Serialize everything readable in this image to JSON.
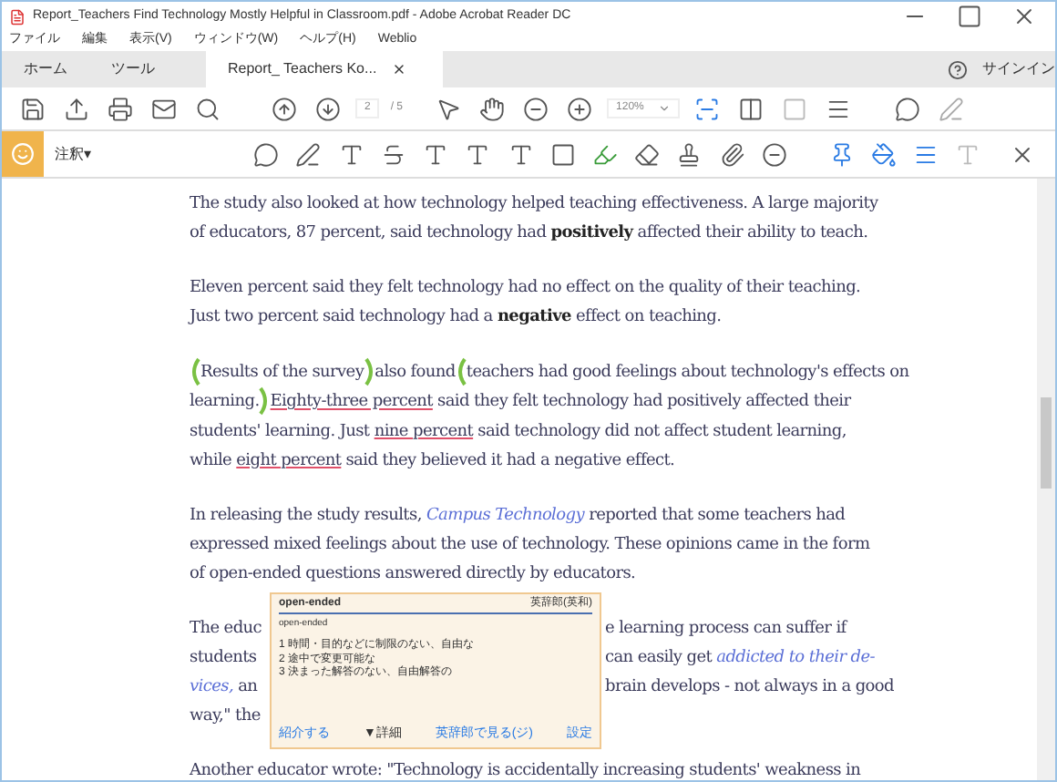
{
  "window": {
    "title": "Report_Teachers Find Technology Mostly Helpful in Classroom.pdf - Adobe Acrobat Reader DC"
  },
  "menu": [
    "ファイル",
    "編集",
    "表示(V)",
    "ウィンドウ(W)",
    "ヘルプ(H)",
    "Weblio"
  ],
  "tabs": [
    {
      "label": "ホーム",
      "selected": false
    },
    {
      "label": "ツール",
      "selected": false
    },
    {
      "label": "Report_ Teachers Ko...",
      "selected": true,
      "kind": "document"
    }
  ],
  "signin": "サインイン",
  "toolbar": {
    "page": "2",
    "pages": "/ 5",
    "zoom": "120%"
  },
  "comment_bar": {
    "label": "注釈▾"
  },
  "paragraphs": [
    {
      "lines": [
        [
          {
            "kind": "plain",
            "text": "The study also looked at how technology helped teaching effectiveness. A large majority"
          }
        ],
        [
          {
            "kind": "plain",
            "text": "of educators, 87 percent, said technology had "
          },
          {
            "kind": "bold",
            "text": "positively"
          },
          {
            "kind": "plain",
            "text": " affected their ability to teach."
          }
        ]
      ]
    },
    {
      "lines": [
        [
          {
            "kind": "plain",
            "text": "Eleven percent said they felt technology had no effect on the quality of their teaching."
          }
        ],
        [
          {
            "kind": "plain",
            "text": "Just two percent said technology had a "
          },
          {
            "kind": "bold",
            "text": "negative"
          },
          {
            "kind": "plain",
            "text": " effect on teaching."
          }
        ]
      ]
    },
    {
      "lines": [
        [
          {
            "kind": "open"
          },
          {
            "kind": "plain",
            "text": "Results of the survey"
          },
          {
            "kind": "close"
          },
          {
            "kind": "plain",
            "text": "also found"
          },
          {
            "kind": "open"
          },
          {
            "kind": "plain",
            "text": "teachers had good feelings about technology's effects on"
          }
        ],
        [
          {
            "kind": "plain",
            "text": "learning."
          },
          {
            "kind": "close"
          },
          {
            "kind": "underline",
            "text": "Eighty-three percent"
          },
          {
            "kind": "plain",
            "text": " said they felt technology had positively affected their"
          }
        ],
        [
          {
            "kind": "plain",
            "text": "students' learning. Just "
          },
          {
            "kind": "underline",
            "text": "nine percent"
          },
          {
            "kind": "plain",
            "text": " said technology did not affect student learning,"
          }
        ],
        [
          {
            "kind": "plain",
            "text": "while "
          },
          {
            "kind": "underline",
            "text": "eight percent"
          },
          {
            "kind": "plain",
            "text": " said they believed it had a negative effect."
          }
        ]
      ]
    },
    {
      "lines": [
        [
          {
            "kind": "plain",
            "text": "In releasing the study results, "
          },
          {
            "kind": "link",
            "text": "Campus Technology"
          },
          {
            "kind": "plain",
            "text": " reported that some teachers had"
          }
        ],
        [
          {
            "kind": "plain",
            "text": "expressed mixed feelings about the use of technology. These opinions came in the form"
          }
        ],
        [
          {
            "kind": "plain",
            "text": "of open-ended questions answered directly by educators."
          }
        ]
      ]
    }
  ],
  "covered_paragraph": {
    "lines": [
      {
        "left": [
          {
            "kind": "plain",
            "text": "The educ"
          }
        ],
        "right": [
          {
            "kind": "plain",
            "text": "e learning process can suffer if"
          }
        ]
      },
      {
        "left": [
          {
            "kind": "plain",
            "text": "students"
          }
        ],
        "right": [
          {
            "kind": "plain",
            "text": "can easily get "
          },
          {
            "kind": "link",
            "text": "addicted to their de-"
          }
        ]
      },
      {
        "left": [
          {
            "kind": "link",
            "text": "vices,"
          },
          {
            "kind": "plain",
            "text": " an"
          }
        ],
        "right": [
          {
            "kind": "plain",
            "text": "brain develops - not always in a good"
          }
        ]
      },
      {
        "left": [
          {
            "kind": "plain",
            "text": "way,\" the"
          }
        ]
      }
    ]
  },
  "last_line": "Another educator wrote: \"Technology is accidentally increasing students' weakness in",
  "popup": {
    "headword": "open-ended",
    "source": "英辞郎(英和)",
    "subhead": "open-ended",
    "senses": [
      "1 時間・目的などに制限のない、自由な",
      "2 途中で変更可能な",
      "3 決まった解答のない、自由解答の"
    ],
    "footer": [
      "紹介する",
      "▼詳細",
      "英辞郎で見る(ジ)",
      "設定"
    ]
  }
}
